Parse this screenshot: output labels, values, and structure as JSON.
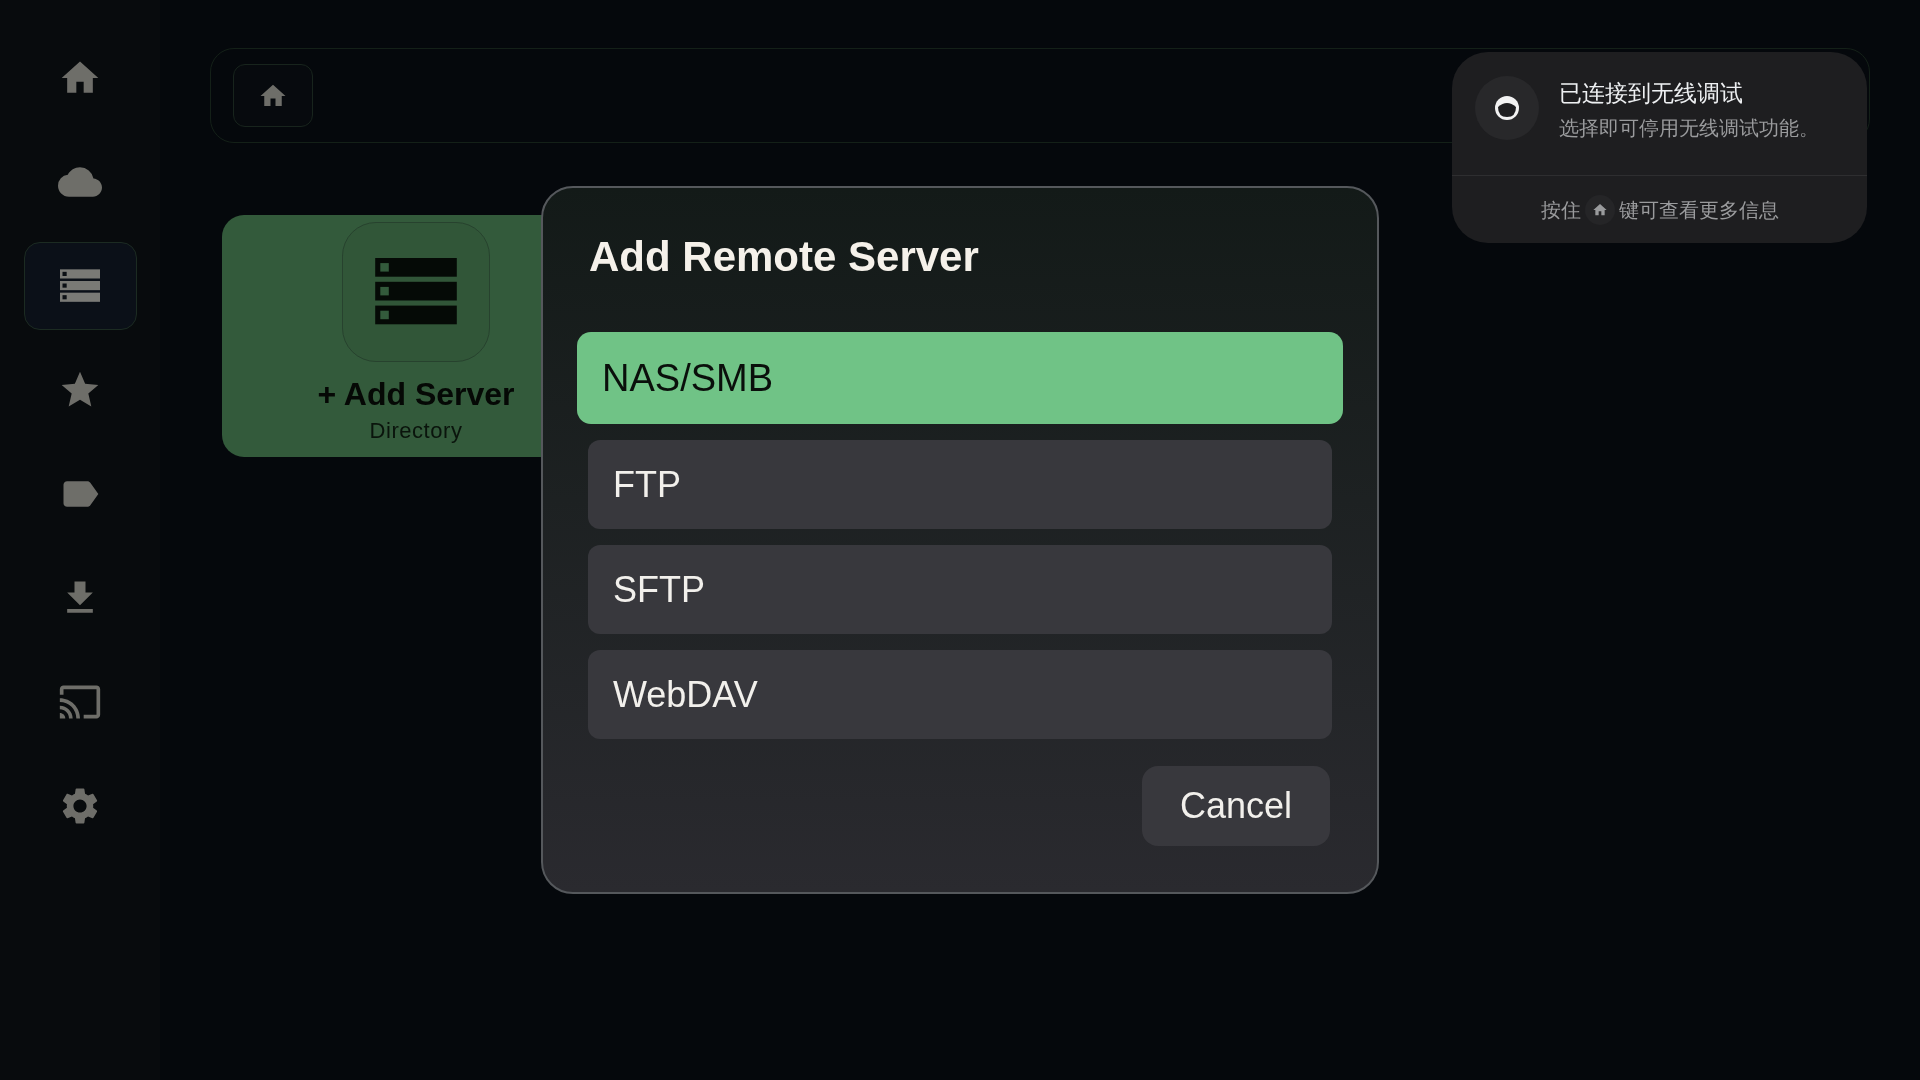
{
  "sidebar": {
    "items": [
      {
        "kind": "home",
        "selected": false
      },
      {
        "kind": "cloud",
        "selected": false
      },
      {
        "kind": "servers",
        "selected": true
      },
      {
        "kind": "favorites",
        "selected": false
      },
      {
        "kind": "tags",
        "selected": false
      },
      {
        "kind": "downloads",
        "selected": false
      },
      {
        "kind": "cast",
        "selected": false
      },
      {
        "kind": "settings",
        "selected": false
      }
    ]
  },
  "server_card": {
    "title": "+ Add Server",
    "subtitle": "Directory"
  },
  "dialog": {
    "title": "Add Remote Server",
    "options": [
      {
        "label": "NAS/SMB",
        "selected": true
      },
      {
        "label": "FTP",
        "selected": false
      },
      {
        "label": "SFTP",
        "selected": false
      },
      {
        "label": "WebDAV",
        "selected": false
      }
    ],
    "cancel": "Cancel"
  },
  "notification": {
    "title": "已连接到无线调试",
    "message": "选择即可停用无线调试功能。",
    "footer_before": "按住",
    "footer_after": "键可查看更多信息"
  }
}
